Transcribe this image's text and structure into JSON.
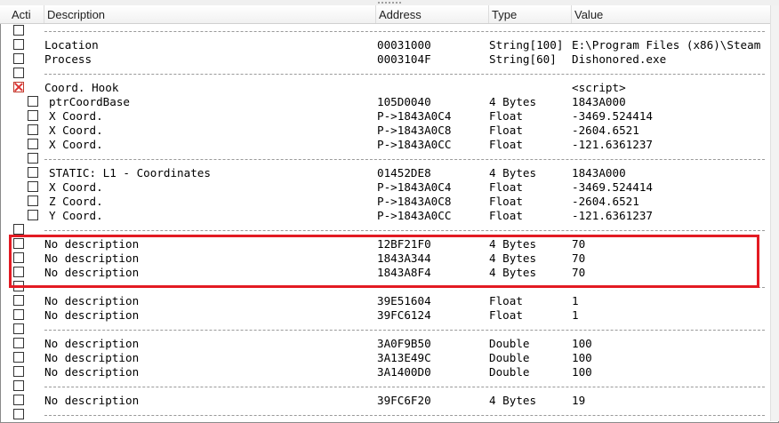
{
  "columns": {
    "active": "Acti",
    "description": "Description",
    "address": "Address",
    "type": "Type",
    "value": "Value"
  },
  "rows": [
    {
      "kind": "sep",
      "indent": 0,
      "checked": false
    },
    {
      "kind": "entry",
      "indent": 0,
      "checked": false,
      "description": "Location",
      "address": "00031000",
      "type": "String[100]",
      "value": "E:\\Program Files (x86)\\Steam"
    },
    {
      "kind": "entry",
      "indent": 0,
      "checked": false,
      "description": "Process",
      "address": "0003104F",
      "type": "String[60]",
      "value": "Dishonored.exe"
    },
    {
      "kind": "sep",
      "indent": 0,
      "checked": false
    },
    {
      "kind": "entry",
      "indent": 0,
      "checked": true,
      "description": "Coord. Hook",
      "address": "",
      "type": "",
      "value": "<script>"
    },
    {
      "kind": "entry",
      "indent": 1,
      "checked": false,
      "description": "ptrCoordBase",
      "address": "105D0040",
      "type": "4 Bytes",
      "value": "1843A000"
    },
    {
      "kind": "entry",
      "indent": 1,
      "checked": false,
      "description": "X Coord.",
      "address": "P->1843A0C4",
      "type": "Float",
      "value": "-3469.524414"
    },
    {
      "kind": "entry",
      "indent": 1,
      "checked": false,
      "description": "X Coord.",
      "address": "P->1843A0C8",
      "type": "Float",
      "value": "-2604.6521"
    },
    {
      "kind": "entry",
      "indent": 1,
      "checked": false,
      "description": "X Coord.",
      "address": "P->1843A0CC",
      "type": "Float",
      "value": "-121.6361237"
    },
    {
      "kind": "sep",
      "indent": 1,
      "checked": false
    },
    {
      "kind": "entry",
      "indent": 1,
      "checked": false,
      "description": "STATIC: L1 - Coordinates",
      "address": "01452DE8",
      "type": "4 Bytes",
      "value": "1843A000"
    },
    {
      "kind": "entry",
      "indent": 1,
      "checked": false,
      "description": "X Coord.",
      "address": "P->1843A0C4",
      "type": "Float",
      "value": "-3469.524414"
    },
    {
      "kind": "entry",
      "indent": 1,
      "checked": false,
      "description": "Z Coord.",
      "address": "P->1843A0C8",
      "type": "Float",
      "value": "-2604.6521"
    },
    {
      "kind": "entry",
      "indent": 1,
      "checked": false,
      "description": "Y Coord.",
      "address": "P->1843A0CC",
      "type": "Float",
      "value": "-121.6361237"
    },
    {
      "kind": "sep",
      "indent": 0,
      "checked": false
    },
    {
      "kind": "entry",
      "indent": 0,
      "checked": false,
      "description": "No description",
      "address": "12BF21F0",
      "type": "4 Bytes",
      "value": "70"
    },
    {
      "kind": "entry",
      "indent": 0,
      "checked": false,
      "description": "No description",
      "address": "1843A344",
      "type": "4 Bytes",
      "value": "70"
    },
    {
      "kind": "entry",
      "indent": 0,
      "checked": false,
      "description": "No description",
      "address": "1843A8F4",
      "type": "4 Bytes",
      "value": "70"
    },
    {
      "kind": "sep",
      "indent": 0,
      "checked": false
    },
    {
      "kind": "entry",
      "indent": 0,
      "checked": false,
      "description": "No description",
      "address": "39E51604",
      "type": "Float",
      "value": "1"
    },
    {
      "kind": "entry",
      "indent": 0,
      "checked": false,
      "description": "No description",
      "address": "39FC6124",
      "type": "Float",
      "value": "1"
    },
    {
      "kind": "sep",
      "indent": 0,
      "checked": false
    },
    {
      "kind": "entry",
      "indent": 0,
      "checked": false,
      "description": "No description",
      "address": "3A0F9B50",
      "type": "Double",
      "value": "100"
    },
    {
      "kind": "entry",
      "indent": 0,
      "checked": false,
      "description": "No description",
      "address": "3A13E49C",
      "type": "Double",
      "value": "100"
    },
    {
      "kind": "entry",
      "indent": 0,
      "checked": false,
      "description": "No description",
      "address": "3A1400D0",
      "type": "Double",
      "value": "100"
    },
    {
      "kind": "sep",
      "indent": 0,
      "checked": false
    },
    {
      "kind": "entry",
      "indent": 0,
      "checked": false,
      "description": "No description",
      "address": "39FC6F20",
      "type": "4 Bytes",
      "value": "19"
    },
    {
      "kind": "sep",
      "indent": 0,
      "checked": false
    }
  ],
  "highlight_color": "#e31b23"
}
